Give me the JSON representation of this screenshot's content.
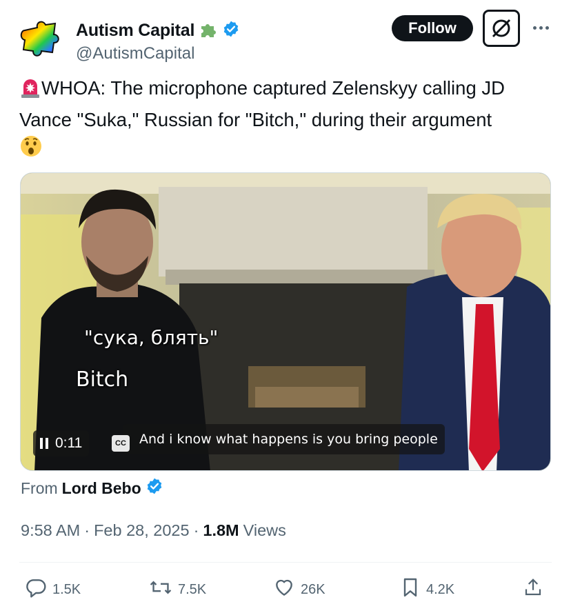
{
  "author": {
    "display_name": "Autism Capital",
    "handle": "@AutismCapital",
    "name_emoji": "puzzle-piece-icon",
    "verified": true
  },
  "header": {
    "follow_label": "Follow"
  },
  "tweet": {
    "siren": "🚨",
    "text": "WHOA: The microphone captured Zelenskyy calling JD Vance \"Suka,\" Russian for \"Bitch,\" during their argument",
    "trailing_emoji": "😲"
  },
  "video": {
    "subtitle_ru": "\"сука, блять\"",
    "subtitle_en": "Bitch",
    "time": "0:11",
    "cc_label": "CC",
    "caption": "And i know what happens is you bring people"
  },
  "source": {
    "prefix": "From",
    "name": "Lord Bebo"
  },
  "meta": {
    "time": "9:58 AM",
    "sep1": "·",
    "date": "Feb 28, 2025",
    "sep2": "·",
    "views_count": "1.8M",
    "views_label": "Views"
  },
  "actions": {
    "replies": "1.5K",
    "reposts": "7.5K",
    "likes": "26K",
    "bookmarks": "4.2K"
  },
  "colors": {
    "verified_blue": "#1d9bf0",
    "text_primary": "#0f1419",
    "text_secondary": "#536471"
  }
}
